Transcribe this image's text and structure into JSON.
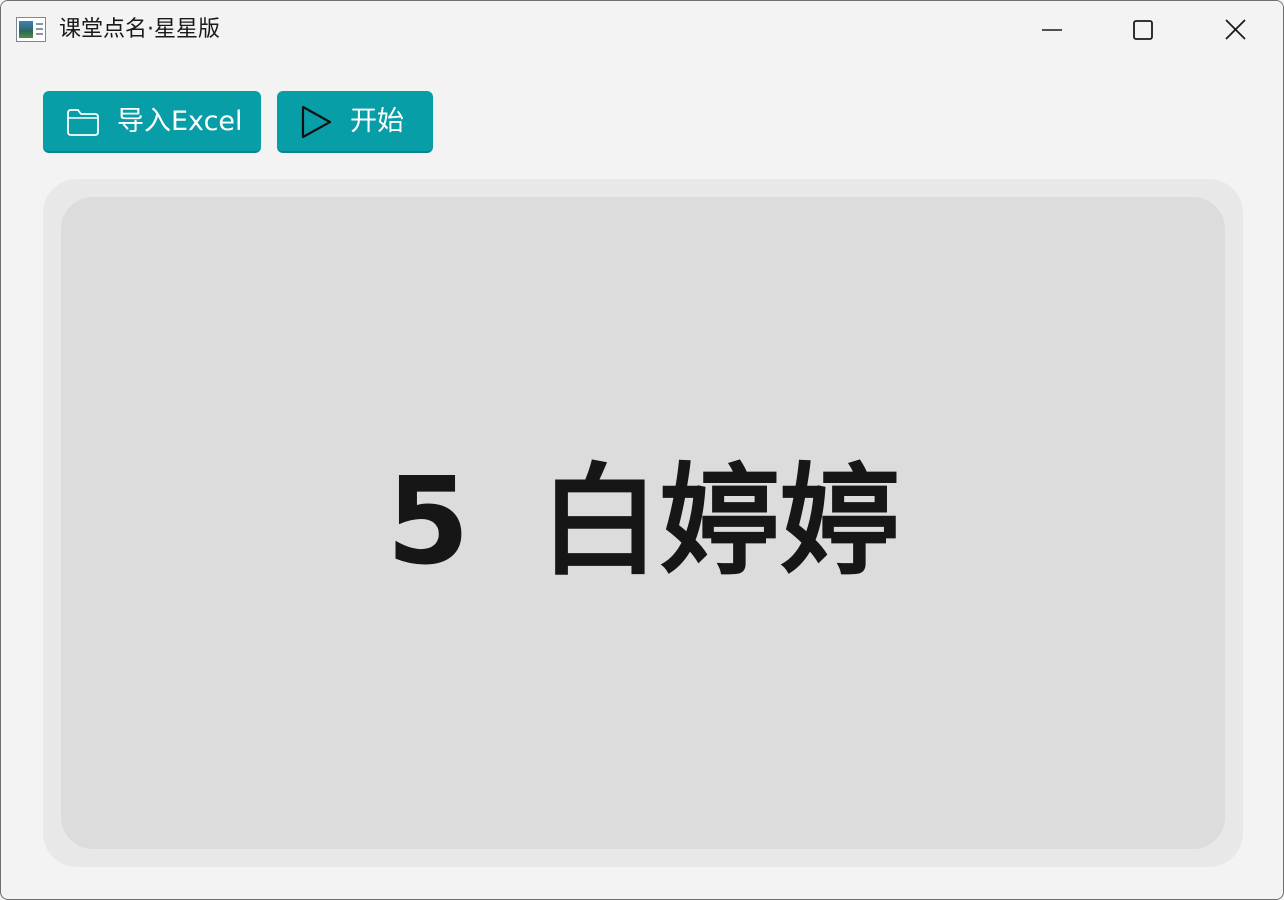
{
  "window": {
    "title": "课堂点名·星星版",
    "icon": "spreadsheet-app-icon",
    "controls": [
      "minimize-icon",
      "maximize-icon",
      "close-icon"
    ]
  },
  "toolbar": {
    "import_label": "导入Excel",
    "import_icon": "folder-icon",
    "start_label": "开始",
    "start_icon": "play-icon",
    "accent_color": "#089ea8"
  },
  "result": {
    "number": "5",
    "name": "白婷婷"
  }
}
